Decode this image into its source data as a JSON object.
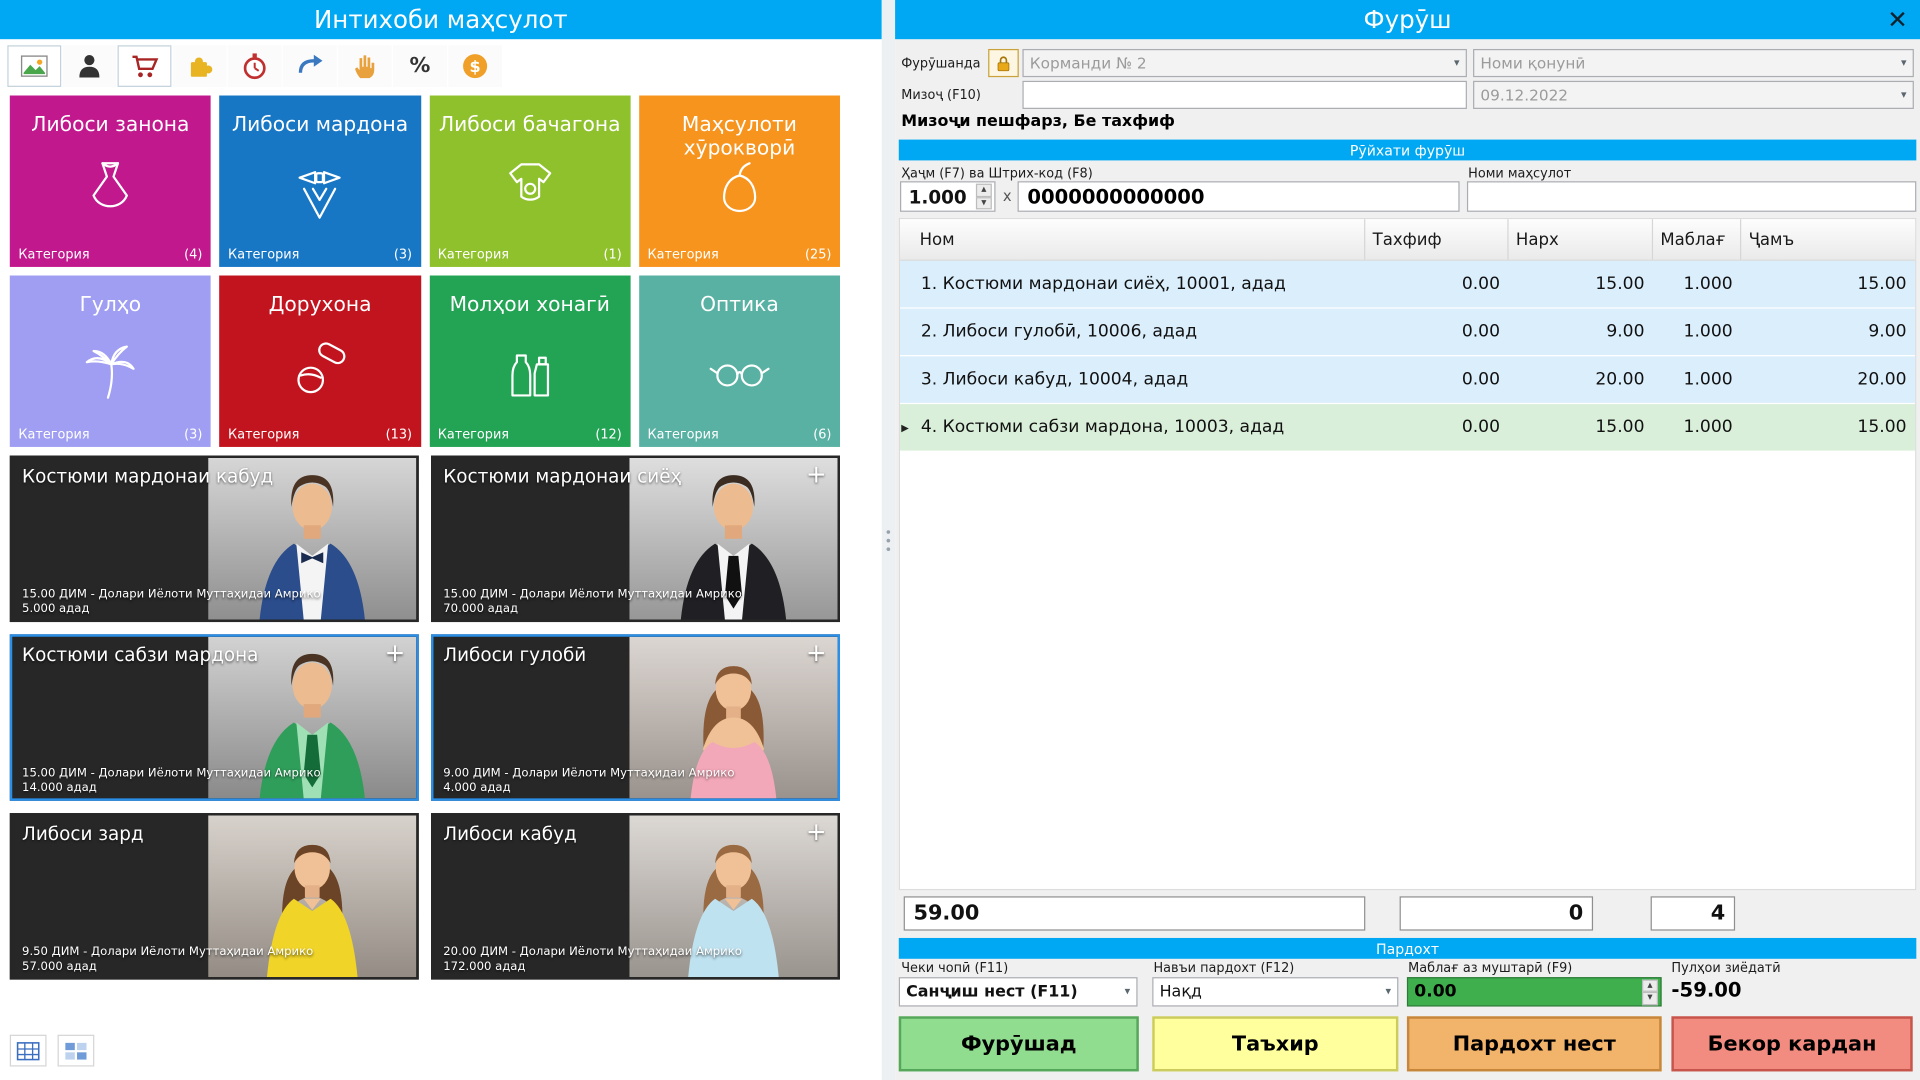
{
  "icons": {
    "close": "✕",
    "dropdown_arrow": "▾",
    "spinner_up": "▲",
    "spinner_down": "▼",
    "row_marker": "▶",
    "percent": "%",
    "dollar": "$",
    "multiply": "x"
  },
  "colors": {
    "header_blue": "#00a7f2",
    "selected_tile_border": "#2a8fe8",
    "row_blue": "#dbeefc",
    "row_green": "#d9efd9",
    "amount_input_green": "#3fae4d"
  },
  "left_panel": {
    "title": "Интихоби маҳсулот",
    "category_label": "Категория",
    "categories": [
      {
        "name": "Либоси занона",
        "count": "(4)",
        "color": "#c2188e",
        "icon": "dress-icon"
      },
      {
        "name": "Либоси мардона",
        "count": "(3)",
        "color": "#1877c5",
        "icon": "suit-icon"
      },
      {
        "name": "Либоси бачагона",
        "count": "(1)",
        "color": "#8fc12c",
        "icon": "baby-clothes-icon"
      },
      {
        "name": "Маҳсулоти хӯрокворӣ",
        "count": "(25)",
        "color": "#f7941e",
        "icon": "pear-icon"
      },
      {
        "name": "Гулҳо",
        "count": "(3)",
        "color": "#9f9ef2",
        "icon": "palm-icon"
      },
      {
        "name": "Дорухона",
        "count": "(13)",
        "color": "#c2141f",
        "icon": "pills-icon"
      },
      {
        "name": "Молҳои хонагӣ",
        "count": "(12)",
        "color": "#23a455",
        "icon": "bottles-icon"
      },
      {
        "name": "Оптика",
        "count": "(6)",
        "color": "#58b1a2",
        "icon": "glasses-icon"
      }
    ],
    "products": [
      {
        "name": "Костюми мардонаи кабуд",
        "price": "15.00 ДИМ - Долари Иёлоти Муттаҳидаи Амрико",
        "qty": "5.000 адад",
        "plus": "",
        "clothing": "#2b4d8c"
      },
      {
        "name": "Костюми мардонаи сиёҳ",
        "price": "15.00 ДИМ - Долари Иёлоти Муттаҳидаи Амрико",
        "qty": "70.000 адад",
        "plus": "+",
        "clothing": "#202024"
      },
      {
        "name": "Костюми сабзи мардона",
        "price": "15.00 ДИМ - Долари Иёлоти Муттаҳидаи Амрико",
        "qty": "14.000 адад",
        "plus": "+",
        "clothing": "#2f9e5a"
      },
      {
        "name": "Либоси гулобӣ",
        "price": "9.00 ДИМ - Долари Иёлоти Муттаҳидаи Амрико",
        "qty": "4.000 адад",
        "plus": "+",
        "clothing": "#f2a8b8"
      },
      {
        "name": "Либоси зард",
        "price": "9.50 ДИМ - Долари Иёлоти Муттаҳидаи Амрико",
        "qty": "57.000 адад",
        "plus": "",
        "clothing": "#f0d428"
      },
      {
        "name": "Либоси кабуд",
        "price": "20.00 ДИМ - Долари Иёлоти Муттаҳидаи Амрико",
        "qty": "172.000 адад",
        "plus": "+",
        "clothing": "#bfe2f0"
      }
    ]
  },
  "right_panel": {
    "title": "Фурӯш",
    "seller": {
      "label": "Фурӯшанда",
      "employee": "Корманди № 2",
      "legal_name": "Номи қонунӣ"
    },
    "client": {
      "label": "Мизоҷ (F10)",
      "value": "",
      "date": "09.12.2022"
    },
    "client_note": "Мизоҷи пешфарз, Бе тахфиф",
    "sales_list_title": "Рӯйхати фурӯш",
    "qty_barcode_label": "Ҳаҷм (F7) ва Штрих-код (F8)",
    "product_name_label": "Номи маҳсулот",
    "qty_value": "1.000",
    "barcode_value": "0000000000000",
    "product_name_value": "",
    "table": {
      "headers": [
        "Ном",
        "Тахфиф",
        "Нарх",
        "Маблағ",
        "Ҷамъ"
      ],
      "rows": [
        {
          "name": "1. Костюми мардонаи сиёҳ, 10001, адад",
          "discount": "0.00",
          "price": "15.00",
          "amount": "1.000",
          "total": "15.00"
        },
        {
          "name": "2. Либоси гулобӣ, 10006, адад",
          "discount": "0.00",
          "price": "9.00",
          "amount": "1.000",
          "total": "9.00"
        },
        {
          "name": "3. Либоси кабуд, 10004, адад",
          "discount": "0.00",
          "price": "20.00",
          "amount": "1.000",
          "total": "20.00"
        },
        {
          "name": "4. Костюми сабзи мардона, 10003, адад",
          "discount": "0.00",
          "price": "15.00",
          "amount": "1.000",
          "total": "15.00"
        }
      ]
    },
    "totals": {
      "sum": "59.00",
      "discount_total": "0",
      "items_count": "4"
    },
    "payment": {
      "title": "Пардохт",
      "receipt_label": "Чеки чопӣ (F11)",
      "receipt_value": "Санҷиш нест (F11)",
      "type_label": "Навъи пардохт (F12)",
      "type_value": "Нақд",
      "customer_amount_label": "Маблағ аз муштарӣ (F9)",
      "customer_amount_value": "0.00",
      "change_label": "Пулҳои зиёдатӣ",
      "change_value": "-59.00",
      "buttons": [
        {
          "label": "Фурӯшад",
          "color": "#90dd90"
        },
        {
          "label": "Таъхир",
          "color": "#ffff9e"
        },
        {
          "label": "Пардохт нест",
          "color": "#f2b36a"
        },
        {
          "label": "Бекор кардан",
          "color": "#f28b80"
        }
      ]
    }
  }
}
